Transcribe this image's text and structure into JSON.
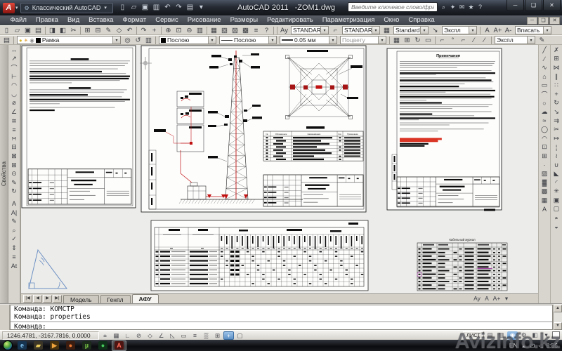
{
  "titlebar": {
    "workspace": "Классический AutoCAD",
    "app_title": "AutoCAD 2011",
    "doc_title": "-ZOM1.dwg",
    "search_placeholder": "Введите ключевое слово/фразу",
    "qat_icons": [
      {
        "n": "new-file",
        "g": "▯"
      },
      {
        "n": "open-file",
        "g": "▱"
      },
      {
        "n": "save",
        "g": "▣"
      },
      {
        "n": "save-as",
        "g": "▥"
      },
      {
        "n": "undo",
        "g": "↶"
      },
      {
        "n": "redo",
        "g": "↷"
      },
      {
        "n": "plot",
        "g": "▤"
      },
      {
        "n": "qat-menu",
        "g": "▾"
      }
    ],
    "search_icons": [
      {
        "n": "search",
        "g": "⌕"
      },
      {
        "n": "exchange",
        "g": "✦"
      },
      {
        "n": "communication-center",
        "g": "✉"
      },
      {
        "n": "favorites",
        "g": "★"
      },
      {
        "n": "help",
        "g": "?"
      }
    ],
    "window_buttons": [
      {
        "n": "minimize",
        "g": "─"
      },
      {
        "n": "restore",
        "g": "❑"
      },
      {
        "n": "close",
        "g": "✕"
      }
    ]
  },
  "menus": [
    {
      "n": "file",
      "label": "Файл"
    },
    {
      "n": "edit",
      "label": "Правка"
    },
    {
      "n": "view",
      "label": "Вид"
    },
    {
      "n": "insert",
      "label": "Вставка"
    },
    {
      "n": "format",
      "label": "Формат"
    },
    {
      "n": "tools",
      "label": "Сервис"
    },
    {
      "n": "draw",
      "label": "Рисование"
    },
    {
      "n": "dimension",
      "label": "Размеры"
    },
    {
      "n": "modify",
      "label": "Редактировать"
    },
    {
      "n": "parametric",
      "label": "Параметризация"
    },
    {
      "n": "window",
      "label": "Окно"
    },
    {
      "n": "help",
      "label": "Справка"
    }
  ],
  "doc_window_buttons": [
    {
      "n": "doc-minimize",
      "g": "─"
    },
    {
      "n": "doc-restore",
      "g": "❑"
    },
    {
      "n": "doc-close",
      "g": "✕"
    }
  ],
  "toolbar1": {
    "icons": [
      {
        "n": "new",
        "g": "▯"
      },
      {
        "n": "open",
        "g": "▱"
      },
      {
        "n": "save",
        "g": "▣"
      },
      {
        "n": "plot",
        "g": "▤"
      },
      {
        "n": "plot-preview",
        "g": "◨"
      },
      {
        "n": "publish",
        "g": "◧"
      },
      {
        "n": "cut",
        "g": "✂"
      },
      {
        "n": "copy-clip",
        "g": "⊞"
      },
      {
        "n": "paste",
        "g": "⊟"
      },
      {
        "n": "match-properties",
        "g": "✎"
      },
      {
        "n": "block-editor",
        "g": "◇"
      },
      {
        "n": "undo",
        "g": "↶"
      },
      {
        "n": "redo",
        "g": "↷"
      },
      {
        "n": "pan",
        "g": "+"
      },
      {
        "n": "zoom-realtime",
        "g": "⊕"
      },
      {
        "n": "zoom-window",
        "g": "⊡"
      },
      {
        "n": "zoom-previous",
        "g": "⊖"
      },
      {
        "n": "properties",
        "g": "▥"
      },
      {
        "n": "design-center",
        "g": "▦"
      },
      {
        "n": "tool-palettes",
        "g": "▧"
      },
      {
        "n": "sheet-set-manager",
        "g": "▨"
      },
      {
        "n": "markup-set-manager",
        "g": "▩"
      },
      {
        "n": "quick-calc",
        "g": "≡"
      },
      {
        "n": "help",
        "g": "?"
      }
    ],
    "text_style": "STANDARD",
    "dim_style": "STANDARD",
    "table_style": "Standard",
    "mleader_style": "Экспл",
    "annotation_scale": "Вписать"
  },
  "toolbar2": {
    "layer": "Рамка",
    "color": "Послою",
    "linetype": "Послою",
    "lineweight": "0.05 мм",
    "plot_style": "Поцвету",
    "ucs_style": "Экспл",
    "layer_icons": [
      {
        "n": "make-object-layer-current",
        "g": "◎"
      },
      {
        "n": "layer-previous",
        "g": "↺"
      },
      {
        "n": "layer-states",
        "g": "▥"
      }
    ],
    "mid_icons": [
      {
        "n": "table-tool",
        "g": "▦"
      },
      {
        "n": "field-tool",
        "g": "⊞"
      },
      {
        "n": "update-fields",
        "g": "↻"
      },
      {
        "n": "ole-object",
        "g": "▭"
      }
    ],
    "ucs_icons": [
      {
        "n": "named-ucs",
        "g": "⌐"
      },
      {
        "n": "ucs-world",
        "g": "°"
      },
      {
        "n": "ucs-previous",
        "g": "⌐"
      },
      {
        "n": "ucs-face",
        "g": "∕"
      },
      {
        "n": "ucs-object",
        "g": "∕"
      }
    ],
    "mleader_icon": {
      "n": "multileader-style",
      "g": "✎"
    }
  },
  "left_palette_tab": "Свойства",
  "left_toolbar_icons": [
    {
      "n": "dim-linear",
      "g": "↔"
    },
    {
      "n": "dim-aligned",
      "g": "↗"
    },
    {
      "n": "dim-arc-length",
      "g": "⌒"
    },
    {
      "n": "dim-ordinate",
      "g": "⊢"
    },
    {
      "n": "dim-radius",
      "g": "◠"
    },
    {
      "n": "dim-jogged",
      "g": "◡"
    },
    {
      "n": "dim-diameter",
      "g": "⌀"
    },
    {
      "n": "dim-angular",
      "g": "∠"
    },
    {
      "n": "quick-dim",
      "g": "≅"
    },
    {
      "n": "dim-baseline",
      "g": "≡"
    },
    {
      "n": "dim-continue",
      "g": "∺"
    },
    {
      "n": "dim-space",
      "g": "⊟"
    },
    {
      "n": "dim-break",
      "g": "⊠"
    },
    {
      "n": "tolerance",
      "g": "⊞"
    },
    {
      "n": "center-mark",
      "g": "⊙"
    },
    {
      "n": "dim-edit",
      "g": "✎"
    },
    {
      "n": "dim-update",
      "g": "↻"
    }
  ],
  "text_toolbar_icons": [
    {
      "n": "mtext",
      "g": "A"
    },
    {
      "n": "single-line-text",
      "g": "A|"
    },
    {
      "n": "edit-text",
      "g": "✎"
    },
    {
      "n": "find-text",
      "g": "⌕"
    },
    {
      "n": "spell-check",
      "g": "✓"
    },
    {
      "n": "text-scale",
      "g": "⇕"
    },
    {
      "n": "text-justify",
      "g": "≡"
    },
    {
      "n": "convert-text",
      "g": "At"
    }
  ],
  "draw_toolbar_icons": [
    {
      "n": "line",
      "g": "╱"
    },
    {
      "n": "construction-line",
      "g": "∕"
    },
    {
      "n": "polyline",
      "g": "∿"
    },
    {
      "n": "polygon",
      "g": "⌂"
    },
    {
      "n": "rectangle",
      "g": "▭"
    },
    {
      "n": "arc",
      "g": "⌒"
    },
    {
      "n": "circle",
      "g": "○"
    },
    {
      "n": "revision-cloud",
      "g": "☁"
    },
    {
      "n": "spline",
      "g": "≈"
    },
    {
      "n": "ellipse",
      "g": "◯"
    },
    {
      "n": "ellipse-arc",
      "g": "◠"
    },
    {
      "n": "insert-block",
      "g": "⊡"
    },
    {
      "n": "create-block",
      "g": "⊞"
    },
    {
      "n": "point",
      "g": "·"
    },
    {
      "n": "hatch",
      "g": "▨"
    },
    {
      "n": "gradient",
      "g": "▓"
    },
    {
      "n": "region",
      "g": "▩"
    },
    {
      "n": "table",
      "g": "▦"
    },
    {
      "n": "mtext2",
      "g": "A"
    }
  ],
  "modify_toolbar_icons": [
    {
      "n": "erase",
      "g": "✗"
    },
    {
      "n": "copy",
      "g": "⊞"
    },
    {
      "n": "mirror",
      "g": "⋈"
    },
    {
      "n": "offset",
      "g": "∥"
    },
    {
      "n": "array",
      "g": "∷"
    },
    {
      "n": "move",
      "g": "+"
    },
    {
      "n": "rotate",
      "g": "↻"
    },
    {
      "n": "scale",
      "g": "↘"
    },
    {
      "n": "stretch",
      "g": "⇉"
    },
    {
      "n": "trim",
      "g": "✂"
    },
    {
      "n": "extend",
      "g": "↦"
    },
    {
      "n": "break-at-point",
      "g": "¦"
    },
    {
      "n": "break",
      "g": "≀"
    },
    {
      "n": "join",
      "g": "∪"
    },
    {
      "n": "chamfer",
      "g": "◣"
    },
    {
      "n": "fillet",
      "g": "◜"
    },
    {
      "n": "explode",
      "g": "✳"
    },
    {
      "n": "bring-to-front",
      "g": "▣"
    },
    {
      "n": "send-to-back",
      "g": "▢"
    },
    {
      "n": "bring-above",
      "g": "◓"
    },
    {
      "n": "send-below",
      "g": "◒"
    }
  ],
  "drawing": {
    "notes_title": "Примечания",
    "spec_headers": [
      "№",
      "Обозначение",
      "Наименование",
      "Кол.",
      "Примечание"
    ],
    "cable_table_title": "Кабельный журнал"
  },
  "tabs": {
    "nav": [
      "|◀",
      "◀",
      "▶",
      "▶|"
    ],
    "items": [
      {
        "n": "model",
        "label": "Модель",
        "active": false
      },
      {
        "n": "genplan",
        "label": "Генпл",
        "active": false
      },
      {
        "n": "afu",
        "label": "АФУ",
        "active": true
      }
    ],
    "right_icons": [
      {
        "n": "annotation-scale",
        "g": "Ay"
      },
      {
        "n": "annotation-visibility",
        "g": "A"
      },
      {
        "n": "annotation-autoscale",
        "g": "A+"
      },
      {
        "n": "tabbar-menu",
        "g": "▾"
      }
    ]
  },
  "command": {
    "history": [
      "Команда: КОМСТР",
      "Команда: properties"
    ],
    "prompt": "Команда:"
  },
  "statusbar": {
    "coords": "1246.4781, -3167.7816, 0.0000",
    "layout_label": "ЛИСТ",
    "toggles": [
      {
        "n": "snap",
        "g": "⌗",
        "on": false
      },
      {
        "n": "grid",
        "g": "▦",
        "on": false
      },
      {
        "n": "ortho",
        "g": "∟",
        "on": false
      },
      {
        "n": "polar",
        "g": "⊘",
        "on": false
      },
      {
        "n": "osnap",
        "g": "◇",
        "on": false
      },
      {
        "n": "otrack",
        "g": "∠",
        "on": false
      },
      {
        "n": "ducs",
        "g": "◺",
        "on": false
      },
      {
        "n": "dynamic-input",
        "g": "▭",
        "on": false
      },
      {
        "n": "lineweight-display",
        "g": "≡",
        "on": false
      },
      {
        "n": "transparency",
        "g": "▒",
        "on": false
      },
      {
        "n": "quick-properties",
        "g": "⊞",
        "on": false
      },
      {
        "n": "selection-cycling",
        "g": "+",
        "on": true
      },
      {
        "n": "annotation-monitor",
        "g": "▢",
        "on": false
      }
    ],
    "right_icons": [
      {
        "n": "quick-view-layouts",
        "g": "▤",
        "hl": false
      },
      {
        "n": "quick-view-drawings",
        "g": "▥",
        "hl": false
      },
      {
        "n": "steering-wheel",
        "g": "◉",
        "hl": true
      },
      {
        "n": "workspace-switching",
        "g": "⚙",
        "hl": false
      },
      {
        "n": "toolbar-lock",
        "g": "◧",
        "hl": false
      },
      {
        "n": "status-menu",
        "g": "▾",
        "hl": false
      }
    ]
  },
  "taskbar": {
    "apps": [
      {
        "n": "internet-explorer",
        "g": "e",
        "bg": "#16334f",
        "fg": "#7fc3f0",
        "active": false
      },
      {
        "n": "windows-explorer",
        "g": "▰",
        "bg": "#3a3526",
        "fg": "#e8c95a",
        "active": false
      },
      {
        "n": "media-player",
        "g": "▶",
        "bg": "#47320f",
        "fg": "#f0a43c",
        "active": false
      },
      {
        "n": "firefox",
        "g": "●",
        "bg": "#3a1d10",
        "fg": "#f07830",
        "active": false
      },
      {
        "n": "utorrent",
        "g": "µ",
        "bg": "#1c2b1c",
        "fg": "#7ed348",
        "active": false
      },
      {
        "n": "green-app",
        "g": "●",
        "bg": "#10301a",
        "fg": "#46c85a",
        "active": false
      },
      {
        "n": "autocad",
        "g": "A",
        "bg": "#4d1512",
        "fg": "#ff6a58",
        "active": true
      }
    ],
    "tray_language": "EN",
    "tray_time": "9:56"
  },
  "watermark": "AvizInfo.kz",
  "colors": {
    "cable_red": "#c11212",
    "highlight_red": "#d9301f",
    "magenta": "#b050b0",
    "triangle_blue": "#6d8fc4",
    "status_active": "#5d8fc4"
  }
}
